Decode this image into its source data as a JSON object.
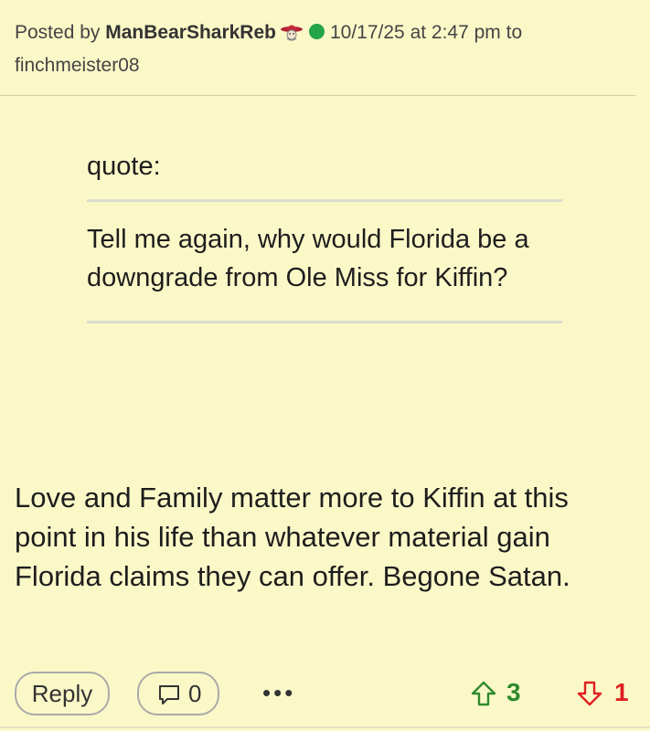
{
  "post": {
    "posted_by_label": "Posted by",
    "author": "ManBearSharkReb",
    "timestamp": "10/17/25 at 2:47 pm",
    "to_label": "to",
    "recipient": "finchmeister08",
    "avatar_icon": "mascot-badge-icon",
    "online_status_color": "#22a447"
  },
  "quote": {
    "label": "quote:",
    "text": "Tell me again, why would Florida be a downgrade from Ole Miss for Kiffin?"
  },
  "body": {
    "text": "Love and Family matter more to Kiffin at this point in his life than whatever material gain Florida claims they can offer. Begone Satan."
  },
  "footer": {
    "reply_label": "Reply",
    "comment_count": "0",
    "more_icon": "ellipsis-icon",
    "upvotes": "3",
    "downvotes": "1",
    "upvote_color": "#2e8b2e",
    "downvote_color": "#e02020"
  }
}
